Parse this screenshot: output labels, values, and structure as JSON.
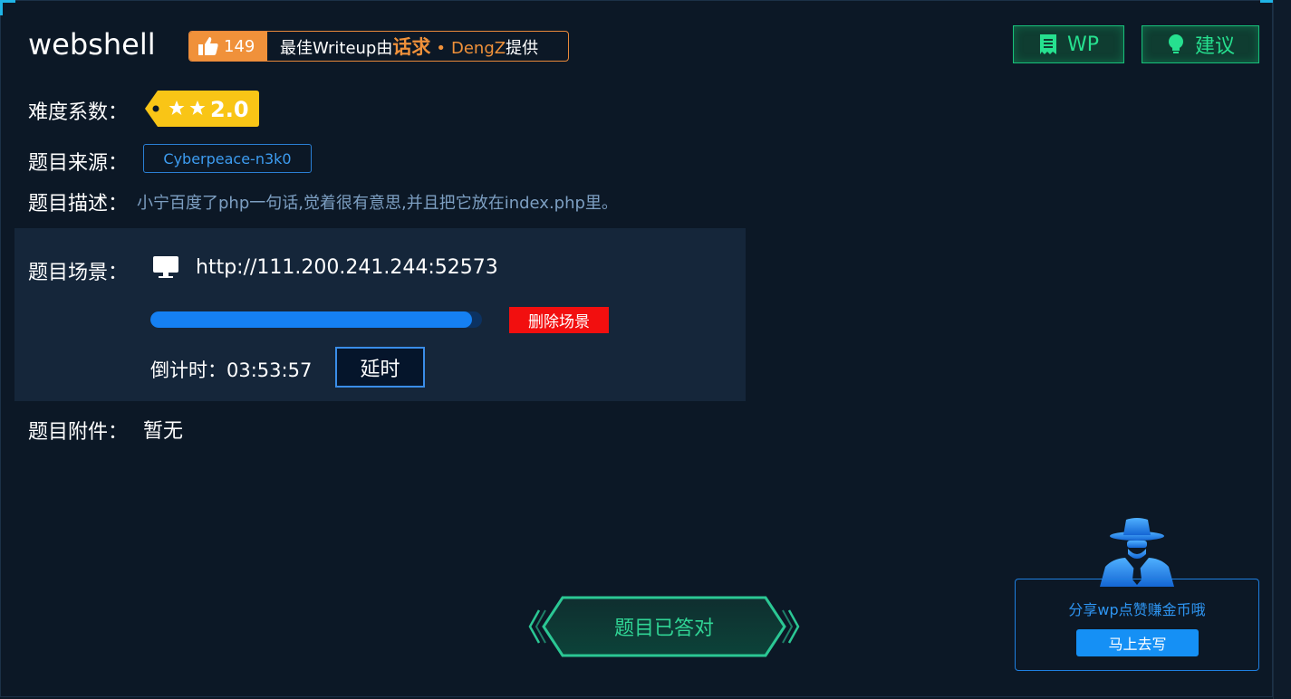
{
  "challenge": {
    "title": "webshell",
    "likes": "149",
    "writeup_prefix": "最佳Writeup由",
    "writeup_author": "话求",
    "writeup_bullet": "•",
    "writeup_coauthor": "DengZ",
    "writeup_suffix": "提供"
  },
  "header_buttons": {
    "wp_label": "WP",
    "suggest_label": "建议"
  },
  "difficulty": {
    "label": "难度系数：",
    "value": "2.0",
    "stars": 2
  },
  "source": {
    "label": "题目来源：",
    "value": "Cyberpeace-n3k0"
  },
  "description": {
    "label": "题目描述：",
    "text": "小宁百度了php一句话,觉着很有意思,并且把它放在index.php里。"
  },
  "scene": {
    "label": "题目场景：",
    "url": "http://111.200.241.244:52573",
    "progress": 0.97,
    "delete_label": "删除场景",
    "countdown_label": "倒计时：",
    "countdown_value": "03:53:57",
    "extend_label": "延时"
  },
  "attachment": {
    "label": "题目附件：",
    "value": "暂无"
  },
  "status": {
    "answered_label": "题目已答对"
  },
  "share": {
    "text": "分享wp点赞赚金币哦",
    "button_label": "马上去写"
  },
  "colors": {
    "accent_green": "#26e08f",
    "accent_blue": "#1580f2",
    "danger": "#f20f0f",
    "orange": "#f0913a"
  }
}
